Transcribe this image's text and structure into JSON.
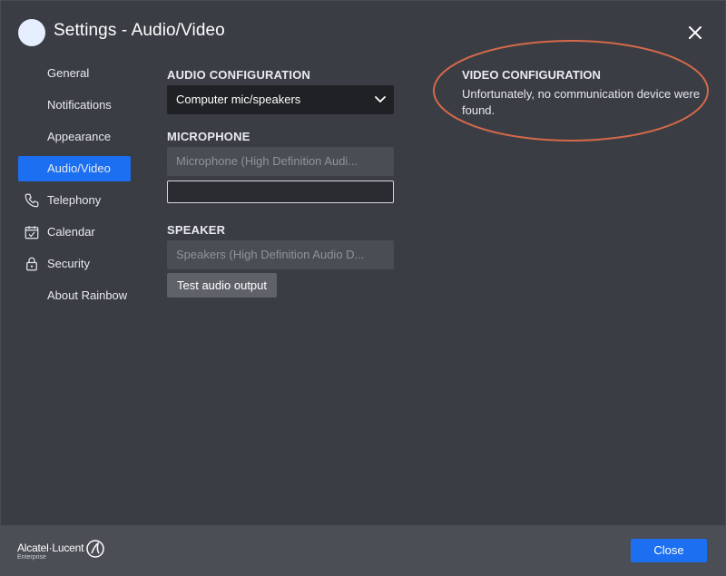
{
  "header": {
    "title": "Settings - Audio/Video",
    "avatar_icon": "user-avatar",
    "close_icon": "close-icon"
  },
  "sidebar": {
    "items": [
      {
        "label": "General",
        "icon": "",
        "active": false
      },
      {
        "label": "Notifications",
        "icon": "",
        "active": false
      },
      {
        "label": "Appearance",
        "icon": "",
        "active": false
      },
      {
        "label": "Audio/Video",
        "icon": "",
        "active": true
      },
      {
        "label": "Telephony",
        "icon": "phone-icon",
        "active": false
      },
      {
        "label": "Calendar",
        "icon": "calendar-icon",
        "active": false
      },
      {
        "label": "Security",
        "icon": "lock-icon",
        "active": false
      },
      {
        "label": "About Rainbow",
        "icon": "",
        "active": false
      }
    ]
  },
  "audio": {
    "section_title": "AUDIO CONFIGURATION",
    "selected": "Computer mic/speakers"
  },
  "microphone": {
    "section_title": "MICROPHONE",
    "device": "Microphone (High Definition Audi...",
    "input_value": ""
  },
  "speaker": {
    "section_title": "SPEAKER",
    "device": "Speakers (High Definition Audio D...",
    "test_button": "Test audio output"
  },
  "video": {
    "section_title": "VIDEO CONFIGURATION",
    "message": "Unfortunately, no communication device were found.",
    "highlight_color": "#d4694a"
  },
  "footer": {
    "logo": "Alcatel·Lucent",
    "logo_sub": "Enterprise",
    "close_button": "Close"
  },
  "colors": {
    "background": "#3a3d44",
    "accent": "#1b6ff0",
    "footer": "#4b4e55"
  }
}
